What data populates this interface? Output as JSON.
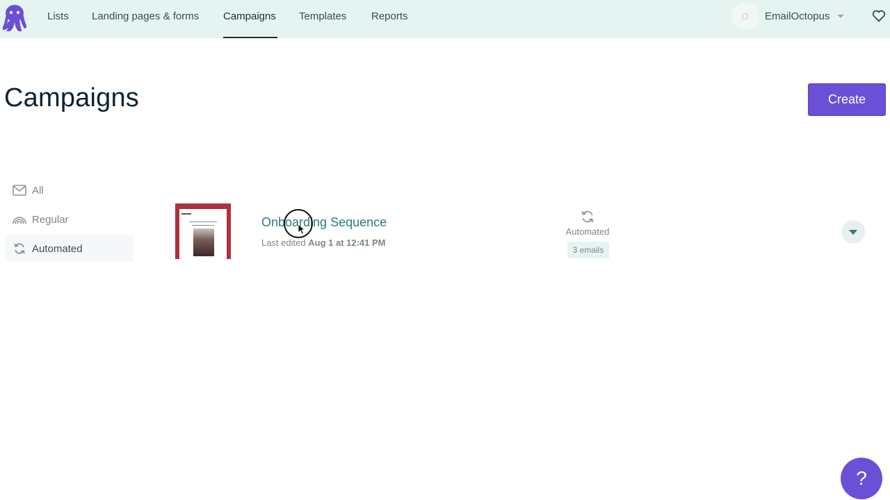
{
  "nav": {
    "items": [
      {
        "label": "Lists"
      },
      {
        "label": "Landing pages & forms"
      },
      {
        "label": "Campaigns"
      },
      {
        "label": "Templates"
      },
      {
        "label": "Reports"
      }
    ],
    "active": "Campaigns",
    "account": {
      "avatar_initial": "O",
      "name": "EmailOctopus"
    }
  },
  "header": {
    "title": "Campaigns",
    "create_label": "Create"
  },
  "filters": {
    "items": [
      {
        "label": "All",
        "icon": "envelope-icon"
      },
      {
        "label": "Regular",
        "icon": "rainbow-icon"
      },
      {
        "label": "Automated",
        "icon": "refresh-icon"
      }
    ],
    "active": "Automated"
  },
  "campaigns": [
    {
      "name": "Onboarding Sequence",
      "edited_prefix": "Last edited",
      "edited_date": "Aug 1 at 12:41 PM",
      "type": "Automated",
      "emails": "3 emails"
    }
  ],
  "help": {
    "label": "?"
  },
  "colors": {
    "brand": "#6b4fd6",
    "topbar": "#e6f4f1",
    "link": "#2a7a7c"
  }
}
